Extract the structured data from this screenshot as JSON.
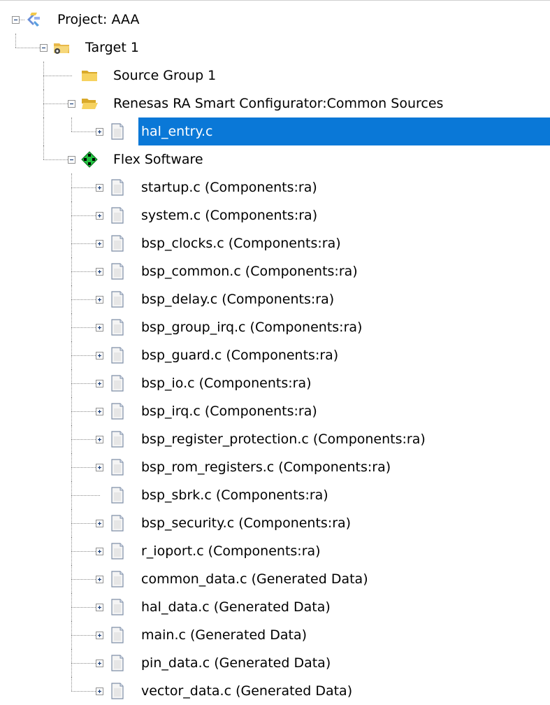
{
  "tree": [
    {
      "label": "Project: AAA",
      "depth": 0,
      "icon": "project-icon",
      "expander": "minus"
    },
    {
      "label": "Target 1",
      "depth": 1,
      "icon": "target-folder-icon",
      "expander": "minus"
    },
    {
      "label": "Source Group 1",
      "depth": 2,
      "icon": "folder-icon",
      "expander": "none"
    },
    {
      "label": "Renesas RA Smart Configurator:Common Sources",
      "depth": 2,
      "icon": "open-folder-icon",
      "expander": "minus"
    },
    {
      "label": "hal_entry.c",
      "depth": 3,
      "icon": "file-icon",
      "expander": "plus",
      "selected": true
    },
    {
      "label": "Flex Software",
      "depth": 2,
      "icon": "component-icon",
      "expander": "minus"
    },
    {
      "label": "startup.c (Components:ra)",
      "depth": 3,
      "icon": "file-icon",
      "expander": "plus"
    },
    {
      "label": "system.c (Components:ra)",
      "depth": 3,
      "icon": "file-icon",
      "expander": "plus"
    },
    {
      "label": "bsp_clocks.c (Components:ra)",
      "depth": 3,
      "icon": "file-icon",
      "expander": "plus"
    },
    {
      "label": "bsp_common.c (Components:ra)",
      "depth": 3,
      "icon": "file-icon",
      "expander": "plus"
    },
    {
      "label": "bsp_delay.c (Components:ra)",
      "depth": 3,
      "icon": "file-icon",
      "expander": "plus"
    },
    {
      "label": "bsp_group_irq.c (Components:ra)",
      "depth": 3,
      "icon": "file-icon",
      "expander": "plus"
    },
    {
      "label": "bsp_guard.c (Components:ra)",
      "depth": 3,
      "icon": "file-icon",
      "expander": "plus"
    },
    {
      "label": "bsp_io.c (Components:ra)",
      "depth": 3,
      "icon": "file-icon",
      "expander": "plus"
    },
    {
      "label": "bsp_irq.c (Components:ra)",
      "depth": 3,
      "icon": "file-icon",
      "expander": "plus"
    },
    {
      "label": "bsp_register_protection.c (Components:ra)",
      "depth": 3,
      "icon": "file-icon",
      "expander": "plus"
    },
    {
      "label": "bsp_rom_registers.c (Components:ra)",
      "depth": 3,
      "icon": "file-icon",
      "expander": "plus"
    },
    {
      "label": "bsp_sbrk.c (Components:ra)",
      "depth": 3,
      "icon": "file-icon",
      "expander": "none"
    },
    {
      "label": "bsp_security.c (Components:ra)",
      "depth": 3,
      "icon": "file-icon",
      "expander": "plus"
    },
    {
      "label": "r_ioport.c (Components:ra)",
      "depth": 3,
      "icon": "file-icon",
      "expander": "plus"
    },
    {
      "label": "common_data.c (Generated Data)",
      "depth": 3,
      "icon": "file-icon",
      "expander": "plus"
    },
    {
      "label": "hal_data.c (Generated Data)",
      "depth": 3,
      "icon": "file-icon",
      "expander": "plus"
    },
    {
      "label": "main.c (Generated Data)",
      "depth": 3,
      "icon": "file-icon",
      "expander": "plus"
    },
    {
      "label": "pin_data.c (Generated Data)",
      "depth": 3,
      "icon": "file-icon",
      "expander": "plus"
    },
    {
      "label": "vector_data.c (Generated Data)",
      "depth": 3,
      "icon": "file-icon",
      "expander": "plus"
    }
  ],
  "colors": {
    "selection": "#0a78d7",
    "folder": "#f2c94c",
    "component": "#22c040"
  }
}
